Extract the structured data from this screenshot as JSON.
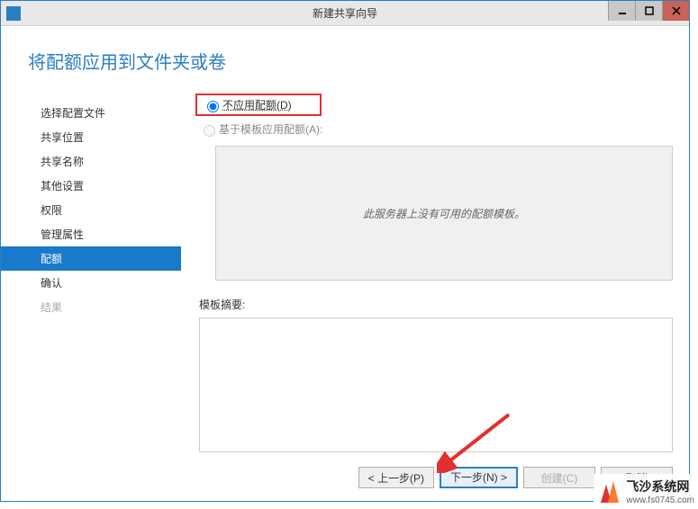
{
  "titlebar": {
    "title": "新建共享向导"
  },
  "header": {
    "page_title": "将配额应用到文件夹或卷"
  },
  "sidebar": {
    "items": [
      {
        "label": "选择配置文件",
        "state": "normal"
      },
      {
        "label": "共享位置",
        "state": "normal"
      },
      {
        "label": "共享名称",
        "state": "normal"
      },
      {
        "label": "其他设置",
        "state": "normal"
      },
      {
        "label": "权限",
        "state": "normal"
      },
      {
        "label": "管理属性",
        "state": "normal"
      },
      {
        "label": "配额",
        "state": "selected"
      },
      {
        "label": "确认",
        "state": "normal"
      },
      {
        "label": "结果",
        "state": "disabled"
      }
    ]
  },
  "main": {
    "radio_no_quota": "不应用配额(D)",
    "radio_template": "基于模板应用配额(A):",
    "no_templates_text": "此服务器上没有可用的配额模板。",
    "summary_label": "模板摘要:"
  },
  "footer": {
    "prev": "< 上一步(P)",
    "next": "下一步(N) >",
    "create": "创建(C)",
    "cancel": "取消"
  },
  "watermark": {
    "title": "飞沙系统网",
    "sub": "www.fs0745.com"
  }
}
